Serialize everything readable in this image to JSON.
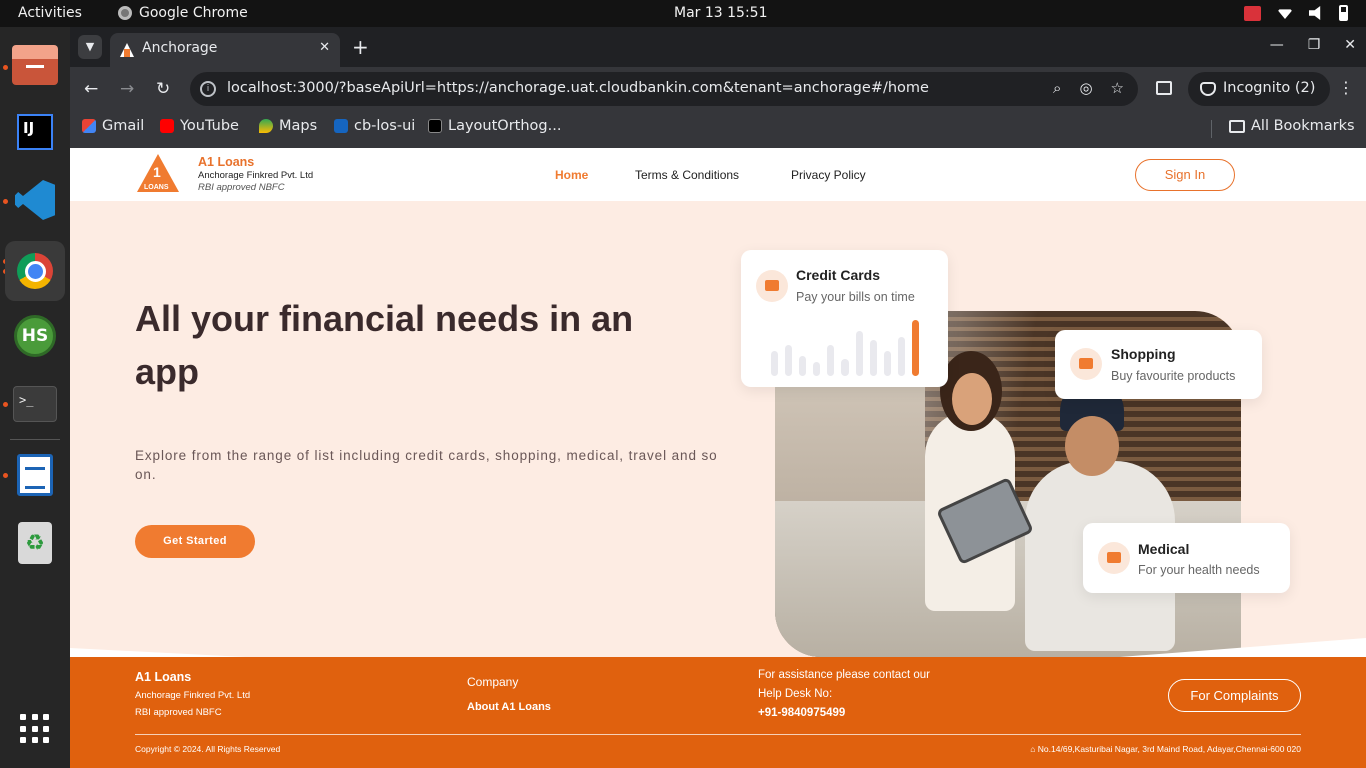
{
  "system_bar": {
    "activities": "Activities",
    "app_name": "Google Chrome",
    "clock": "Mar 13  15:51"
  },
  "dock": {
    "items": [
      "files-icon",
      "intellij-icon",
      "vscode-icon",
      "chrome-icon",
      "hs-icon",
      "terminal-icon",
      "document-viewer-icon",
      "trash-icon",
      "app-grid-icon"
    ],
    "hs_label": "HS",
    "ij_label": "IJ",
    "terminal_label": ">_"
  },
  "browser": {
    "tab_title": "Anchorage",
    "url": "localhost:3000/?baseApiUrl=https://anchorage.uat.cloudbankin.com&tenant=anchorage#/home",
    "incognito_label": "Incognito (2)",
    "bookmarks": [
      "Gmail",
      "YouTube",
      "Maps",
      "cb-los-ui",
      "LayoutOrthog..."
    ],
    "all_bookmarks": "All Bookmarks"
  },
  "site": {
    "brand": {
      "logo_number": "1",
      "logo_word": "LOANS",
      "name": "A1 Loans",
      "company": "Anchorage Finkred Pvt. Ltd",
      "tagline": "RBI approved NBFC"
    },
    "nav": {
      "home": "Home",
      "terms": "Terms & Conditions",
      "privacy": "Privacy Policy",
      "signin": "Sign In"
    },
    "hero": {
      "title": "All your financial needs in an app",
      "description": "Explore from the range of list including credit cards, shopping, medical, travel and so on.",
      "cta": "Get Started"
    },
    "cards": {
      "credit": {
        "title": "Credit Cards",
        "subtitle": "Pay your bills on time"
      },
      "shopping": {
        "title": "Shopping",
        "subtitle": "Buy favourite products"
      },
      "medical": {
        "title": "Medical",
        "subtitle": "For your health needs"
      }
    },
    "credit_card_bars": [
      0.45,
      0.55,
      0.35,
      0.25,
      0.55,
      0.3,
      0.8,
      0.65,
      0.45,
      0.7,
      1.0
    ],
    "footer": {
      "name": "A1 Loans",
      "company": "Anchorage Finkred Pvt. Ltd",
      "tagline": "RBI approved NBFC",
      "company_heading": "Company",
      "about_link": "About A1 Loans",
      "help_line1": "For assistance please contact our",
      "help_line2": "Help Desk No:",
      "phone": "+91-9840975499",
      "complaints": "For Complaints",
      "copyright": "Copyright © 2024. All Rights Reserved",
      "address": "⌂ No.14/69,Kasturibai Nagar, 3rd Maind Road, Adayar,Chennai-600 020"
    },
    "colors": {
      "accent": "#f07b30",
      "footer_bg": "#e0610e",
      "hero_bg": "#fdece3"
    }
  }
}
